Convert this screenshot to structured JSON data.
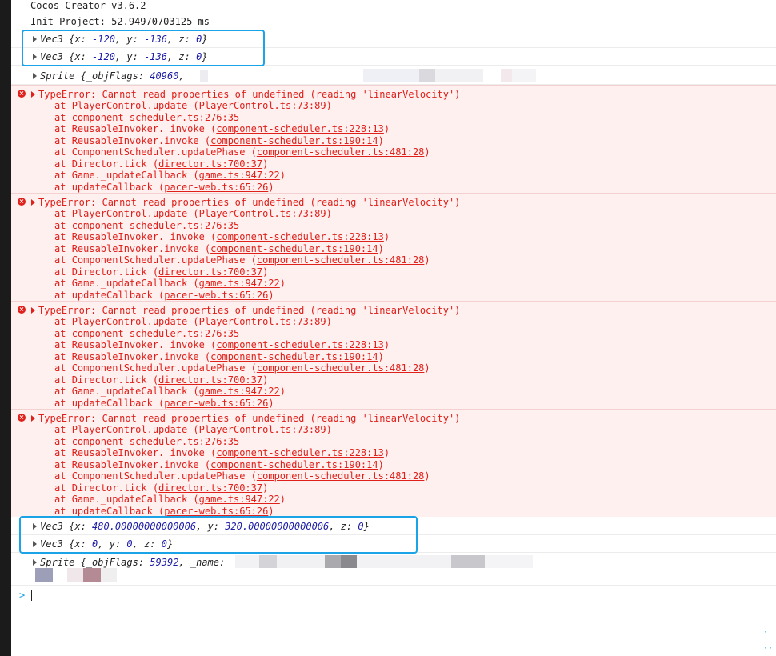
{
  "logs": {
    "version": "Cocos Creator v3.6.2",
    "init": "Init Project: 52.94970703125 ms"
  },
  "vec_top": [
    {
      "name": "Vec3",
      "x": "-120",
      "y": "-136",
      "z": "0"
    },
    {
      "name": "Vec3",
      "x": "-120",
      "y": "-136",
      "z": "0"
    }
  ],
  "sprite1": {
    "name": "Sprite",
    "key": "_objFlags",
    "value": "40960"
  },
  "errors": [
    {
      "message": "TypeError: Cannot read properties of undefined (reading 'linearVelocity')",
      "frames": [
        {
          "fn": "PlayerControl.update",
          "loc": "PlayerControl.ts:73:89"
        },
        {
          "fn": "component-scheduler.ts:276:35",
          "loc": ""
        },
        {
          "fn": "ReusableInvoker._invoke",
          "loc": "component-scheduler.ts:228:13"
        },
        {
          "fn": "ReusableInvoker.invoke",
          "loc": "component-scheduler.ts:190:14"
        },
        {
          "fn": "ComponentScheduler.updatePhase",
          "loc": "component-scheduler.ts:481:28"
        },
        {
          "fn": "Director.tick",
          "loc": "director.ts:700:37"
        },
        {
          "fn": "Game._updateCallback",
          "loc": "game.ts:947:22"
        },
        {
          "fn": "updateCallback",
          "loc": "pacer-web.ts:65:26"
        }
      ]
    },
    {
      "message": "TypeError: Cannot read properties of undefined (reading 'linearVelocity')",
      "frames": [
        {
          "fn": "PlayerControl.update",
          "loc": "PlayerControl.ts:73:89"
        },
        {
          "fn": "component-scheduler.ts:276:35",
          "loc": ""
        },
        {
          "fn": "ReusableInvoker._invoke",
          "loc": "component-scheduler.ts:228:13"
        },
        {
          "fn": "ReusableInvoker.invoke",
          "loc": "component-scheduler.ts:190:14"
        },
        {
          "fn": "ComponentScheduler.updatePhase",
          "loc": "component-scheduler.ts:481:28"
        },
        {
          "fn": "Director.tick",
          "loc": "director.ts:700:37"
        },
        {
          "fn": "Game._updateCallback",
          "loc": "game.ts:947:22"
        },
        {
          "fn": "updateCallback",
          "loc": "pacer-web.ts:65:26"
        }
      ]
    },
    {
      "message": "TypeError: Cannot read properties of undefined (reading 'linearVelocity')",
      "frames": [
        {
          "fn": "PlayerControl.update",
          "loc": "PlayerControl.ts:73:89"
        },
        {
          "fn": "component-scheduler.ts:276:35",
          "loc": ""
        },
        {
          "fn": "ReusableInvoker._invoke",
          "loc": "component-scheduler.ts:228:13"
        },
        {
          "fn": "ReusableInvoker.invoke",
          "loc": "component-scheduler.ts:190:14"
        },
        {
          "fn": "ComponentScheduler.updatePhase",
          "loc": "component-scheduler.ts:481:28"
        },
        {
          "fn": "Director.tick",
          "loc": "director.ts:700:37"
        },
        {
          "fn": "Game._updateCallback",
          "loc": "game.ts:947:22"
        },
        {
          "fn": "updateCallback",
          "loc": "pacer-web.ts:65:26"
        }
      ]
    },
    {
      "message": "TypeError: Cannot read properties of undefined (reading 'linearVelocity')",
      "frames": [
        {
          "fn": "PlayerControl.update",
          "loc": "PlayerControl.ts:73:89"
        },
        {
          "fn": "component-scheduler.ts:276:35",
          "loc": ""
        },
        {
          "fn": "ReusableInvoker._invoke",
          "loc": "component-scheduler.ts:228:13"
        },
        {
          "fn": "ReusableInvoker.invoke",
          "loc": "component-scheduler.ts:190:14"
        },
        {
          "fn": "ComponentScheduler.updatePhase",
          "loc": "component-scheduler.ts:481:28"
        },
        {
          "fn": "Director.tick",
          "loc": "director.ts:700:37"
        },
        {
          "fn": "Game._updateCallback",
          "loc": "game.ts:947:22"
        },
        {
          "fn": "updateCallback",
          "loc": "pacer-web.ts:65:26"
        }
      ]
    }
  ],
  "frame_prefix": "at",
  "vec_bottom": [
    {
      "name": "Vec3",
      "x": "480.00000000000006",
      "y": "320.00000000000006",
      "z": "0"
    },
    {
      "name": "Vec3",
      "x": "0",
      "y": "0",
      "z": "0"
    }
  ],
  "sprite2": {
    "name": "Sprite",
    "key": "_objFlags",
    "value": "59392",
    "key2": "_name:"
  },
  "prompt_symbol": ">",
  "colors": {
    "error": "#e0201a",
    "highlight": "#1aa3e6",
    "number": "#1a1aa6"
  }
}
